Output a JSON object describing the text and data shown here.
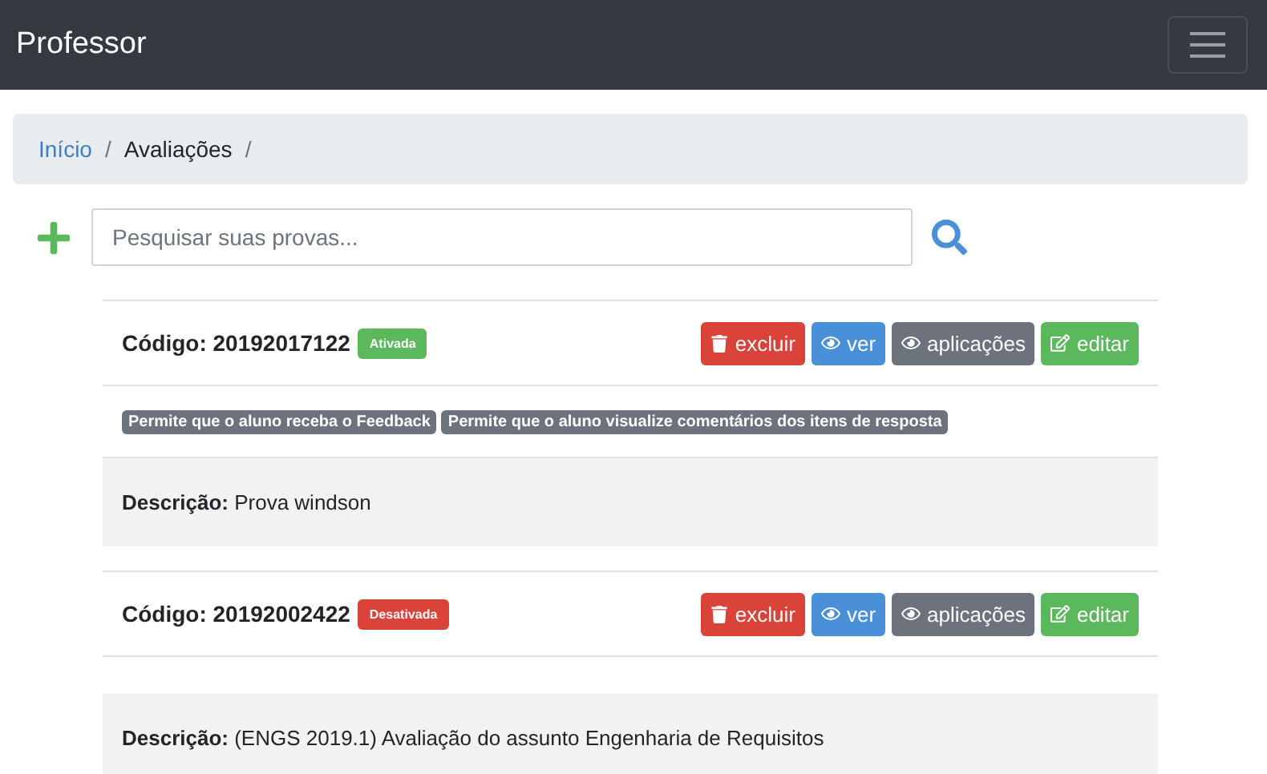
{
  "navbar": {
    "brand": "Professor"
  },
  "breadcrumb": [
    {
      "label": "Início",
      "link": true
    },
    {
      "label": "Avaliações",
      "link": false
    }
  ],
  "breadcrumb_separator": "/",
  "search": {
    "placeholder": "Pesquisar suas provas..."
  },
  "exams": [
    {
      "code": "Código: 20192017122",
      "status": {
        "label": "Ativada",
        "active": true
      },
      "buttons": [
        {
          "label": "excluir",
          "kind": "delete"
        },
        {
          "label": "ver",
          "kind": "view"
        },
        {
          "label": "aplicações",
          "kind": "applications"
        },
        {
          "label": "editar",
          "kind": "edit"
        }
      ],
      "tags": [
        "Permite que o aluno receba o Feedback",
        "Permite que o aluno visualize comentários dos itens de resposta"
      ],
      "description": "**Descrição:** Prova windson"
    },
    {
      "code": "Código: 20192002422",
      "status": {
        "label": "Desativada",
        "active": false
      },
      "buttons": [
        {
          "label": "excluir",
          "kind": "delete"
        },
        {
          "label": "ver",
          "kind": "view"
        },
        {
          "label": "aplicações",
          "kind": "applications"
        },
        {
          "label": "editar",
          "kind": "edit"
        }
      ],
      "description": "**Descrição:** (ENGS 2019.1) Avaliação do assunto Engenharia de Requisitos"
    }
  ]
}
